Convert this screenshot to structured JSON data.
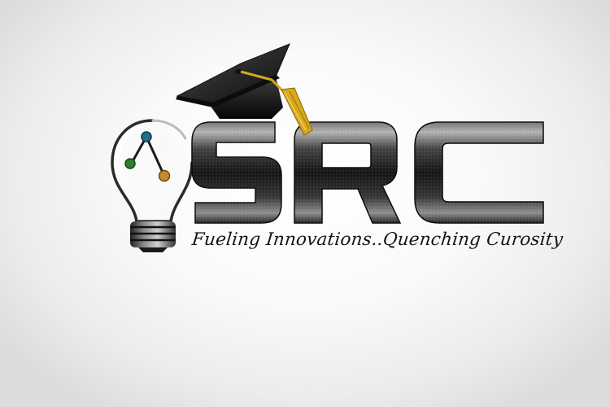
{
  "logo": {
    "wordmark": "SRC",
    "tagline": "Fueling Innovations..Quenching Curosity",
    "icons": [
      "lightbulb-icon",
      "graduation-cap-icon",
      "node-graph-icon"
    ],
    "colors": {
      "metal_dark": "#141414",
      "metal_light": "#bcbcbc",
      "tassel": "#d9a81c",
      "node_blue": "#1f6f8b",
      "node_green": "#2e7d32",
      "node_amber": "#c58b2a",
      "background": "#ffffff"
    }
  }
}
